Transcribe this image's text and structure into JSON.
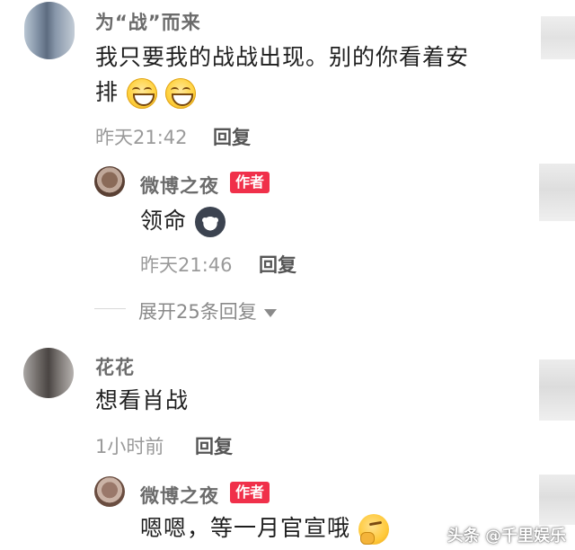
{
  "comments": [
    {
      "author": "为“战”而来",
      "text_line1": "我只要我的战战出现。别的你看着安",
      "text_line2": "排",
      "time": "昨天21:42",
      "reply_label": "回复",
      "reply": {
        "author": "微博之夜",
        "badge": "作者",
        "text": "领命",
        "time": "昨天21:46",
        "reply_label": "回复"
      },
      "expand_label": "展开25条回复"
    },
    {
      "author": "花花",
      "text": "想看肖战",
      "time": "1小时前",
      "reply_label": "回复",
      "reply": {
        "author": "微博之夜",
        "badge": "作者",
        "text": "嗯嗯，等一月官宣哦"
      }
    }
  ],
  "watermark": "头条 @千里娱乐",
  "colors": {
    "badge": "#f0304a",
    "meta": "#9a9a9a",
    "name": "#6b6b6b"
  },
  "icons": [
    "grin-emoji-icon",
    "husky-emoji-icon",
    "thinking-emoji-icon",
    "caret-down-icon"
  ]
}
